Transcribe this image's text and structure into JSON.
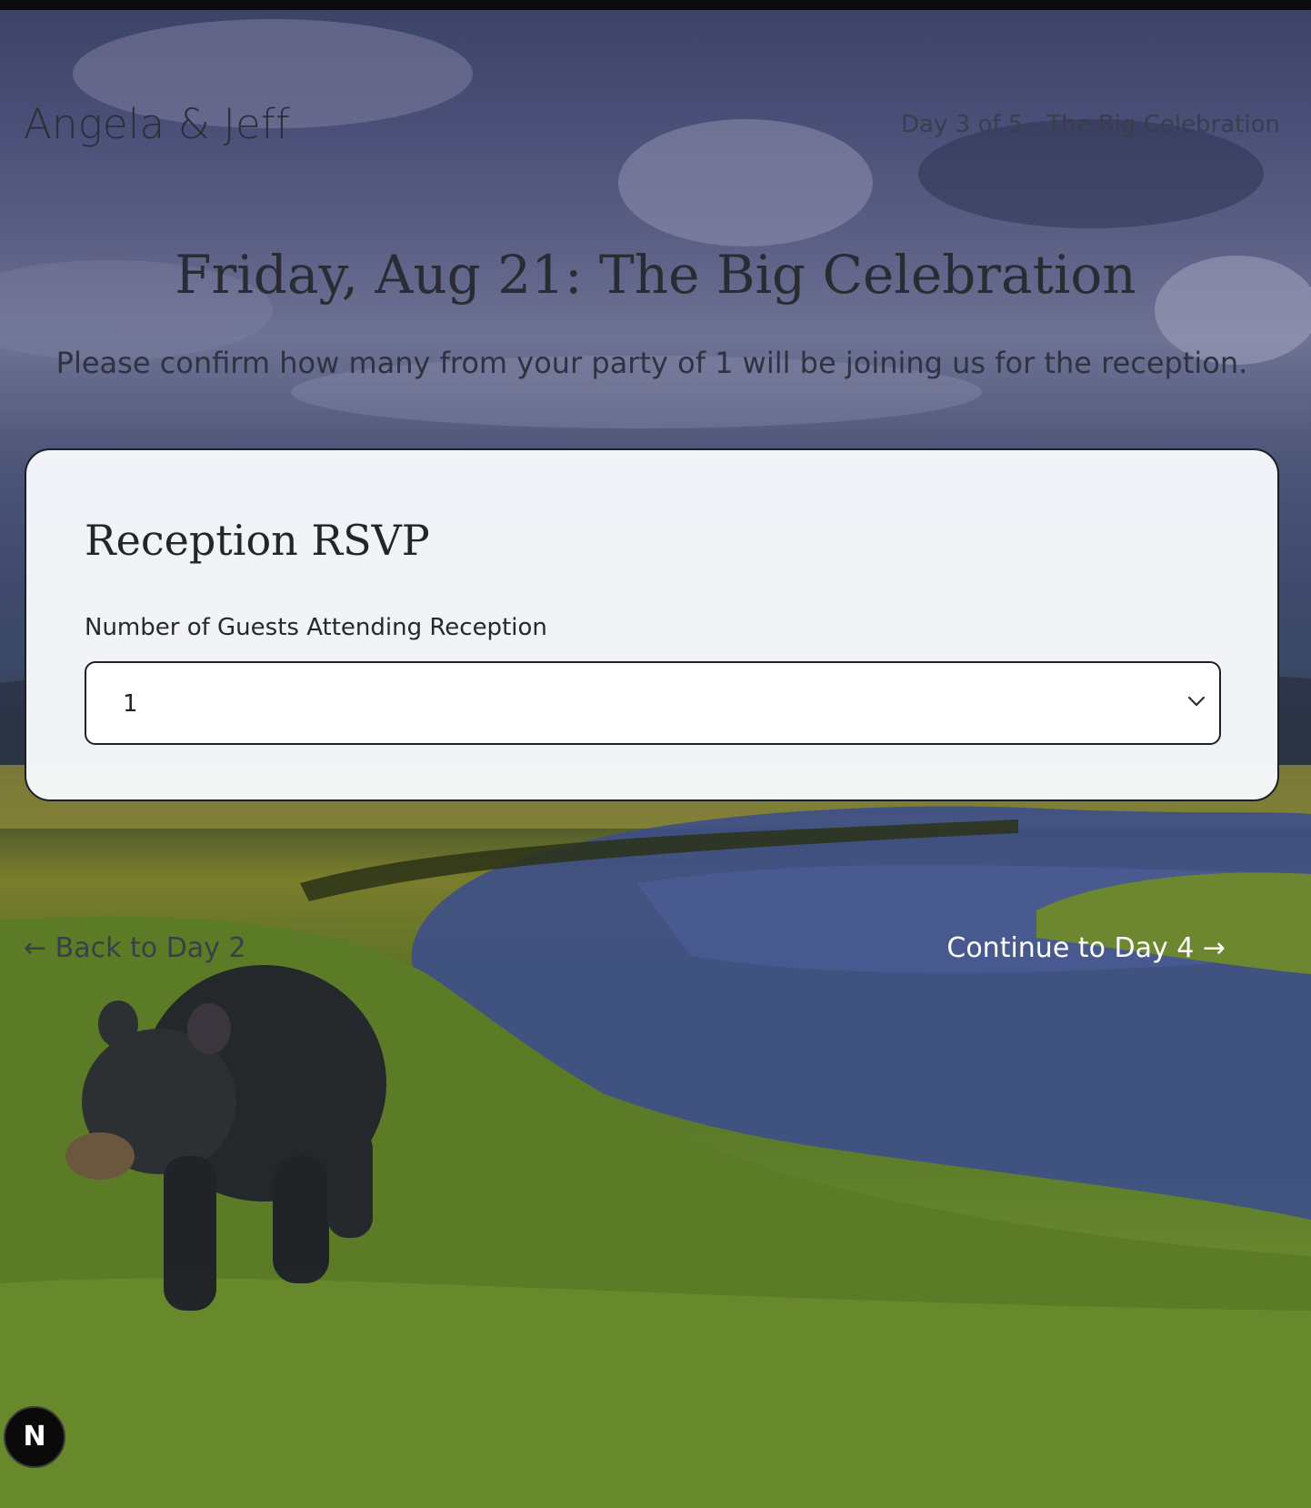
{
  "header": {
    "brand": "Angela & Jeff",
    "day_indicator": "Day 3 of 5 - The Big Celebration"
  },
  "main": {
    "title": "Friday, Aug 21: The Big Celebration",
    "subtitle": "Please confirm how many from your party of 1 will be joining us for the reception."
  },
  "rsvp_card": {
    "title": "Reception RSVP",
    "guests_label": "Number of Guests Attending Reception",
    "guests_selected": "1"
  },
  "navigation": {
    "back_label": "← Back to Day 2",
    "next_label": "Continue to Day 4 →"
  },
  "dev_badge": {
    "letter": "N"
  },
  "colors": {
    "card_background": "#f8f9fc",
    "card_border": "#1d1f26",
    "next_link": "#ffffff",
    "back_link": "#3b3f4a"
  }
}
